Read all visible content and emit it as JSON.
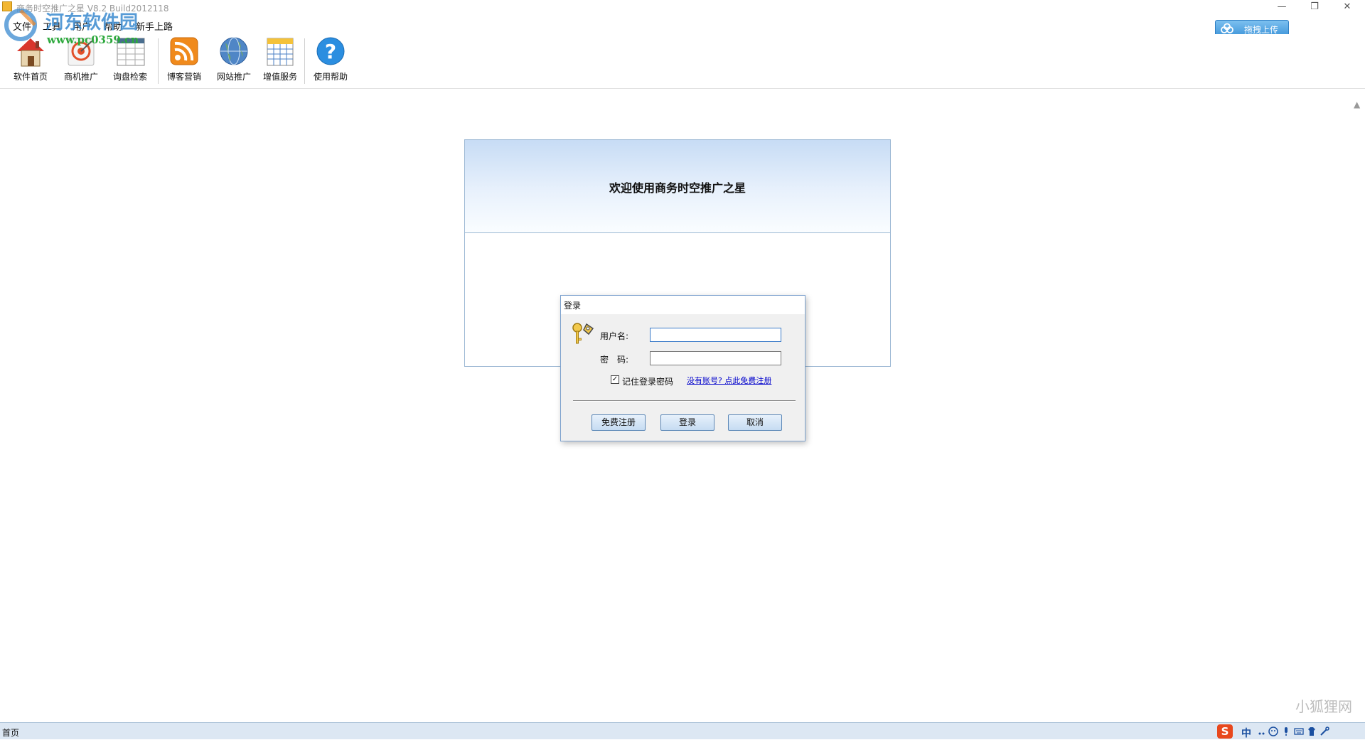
{
  "window": {
    "title": "商务时空推广之星 V8.2 Build2012118",
    "min": "—",
    "max": "❐",
    "close": "✕"
  },
  "menu": [
    "文件",
    "工具",
    "用户",
    "帮助",
    "新手上路"
  ],
  "watermark": {
    "text": "河东软件园",
    "url": "www.pc0359.cn",
    "corner": "小狐狸网"
  },
  "upload_button": {
    "label": "拖拽上传"
  },
  "toolbar": [
    {
      "label": "软件首页",
      "icon": "house-icon"
    },
    {
      "label": "商机推广",
      "icon": "target-icon"
    },
    {
      "label": "询盘检索",
      "icon": "table-icon"
    },
    {
      "label": "博客营销",
      "icon": "rss-icon"
    },
    {
      "label": "网站推广",
      "icon": "globe-icon"
    },
    {
      "label": "增值服务",
      "icon": "calendar-icon"
    },
    {
      "label": "使用帮助",
      "icon": "help-icon"
    }
  ],
  "welcome": {
    "title": "欢迎使用商务时空推广之星"
  },
  "login": {
    "title": "登录",
    "username_label": "用户名:",
    "username_value": "",
    "password_label": "密　码:",
    "password_value": "",
    "remember_label": "记住登录密码",
    "remember_checked": "✓",
    "register_link": "没有账号? 点此免费注册",
    "buttons": {
      "register": "免费注册",
      "login": "登录",
      "cancel": "取消"
    }
  },
  "status": {
    "text": "首页"
  },
  "ime": {
    "logo": "S",
    "mode": "中"
  },
  "colors": {
    "accent": "#3f95da",
    "panel_border": "#9cb8d4",
    "statusbar": "#dce7f3",
    "link": "#0000cc"
  }
}
